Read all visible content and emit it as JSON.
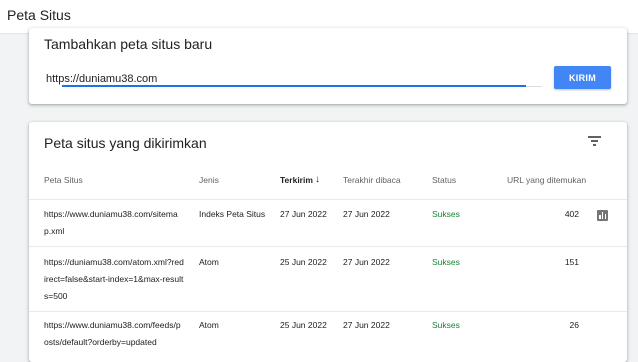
{
  "header": {
    "title": "Peta Situs"
  },
  "add_card": {
    "heading": "Tambahkan peta situs baru",
    "input_value": "https://duniamu38.com",
    "submit_label": "KIRIM"
  },
  "list_card": {
    "heading": "Peta situs yang dikirimkan",
    "columns": {
      "sitemap": "Peta Situs",
      "type": "Jenis",
      "submitted": "Terkirim",
      "last_read": "Terakhir dibaca",
      "status": "Status",
      "urls": "URL yang ditemukan"
    },
    "rows": [
      {
        "url": "https://www.duniamu38.com/sitemap.xml",
        "type": "Indeks Peta Situs",
        "submitted": "27 Jun 2022",
        "last_read": "27 Jun 2022",
        "status": "Sukses",
        "urls": "402"
      },
      {
        "url": "https://duniamu38.com/atom.xml?redirect=false&start-index=1&max-results=500",
        "type": "Atom",
        "submitted": "25 Jun 2022",
        "last_read": "27 Jun 2022",
        "status": "Sukses",
        "urls": "151"
      },
      {
        "url": "https://www.duniamu38.com/feeds/posts/default?orderby=updated",
        "type": "Atom",
        "submitted": "25 Jun 2022",
        "last_read": "27 Jun 2022",
        "status": "Sukses",
        "urls": "26"
      }
    ]
  },
  "icons": {
    "filter": "filter-list-icon",
    "sort": "arrow-downward-icon",
    "chart": "bar-chart-icon"
  },
  "colors": {
    "accent": "#4285f4",
    "success": "#188038",
    "underline": "#1a73e8"
  }
}
